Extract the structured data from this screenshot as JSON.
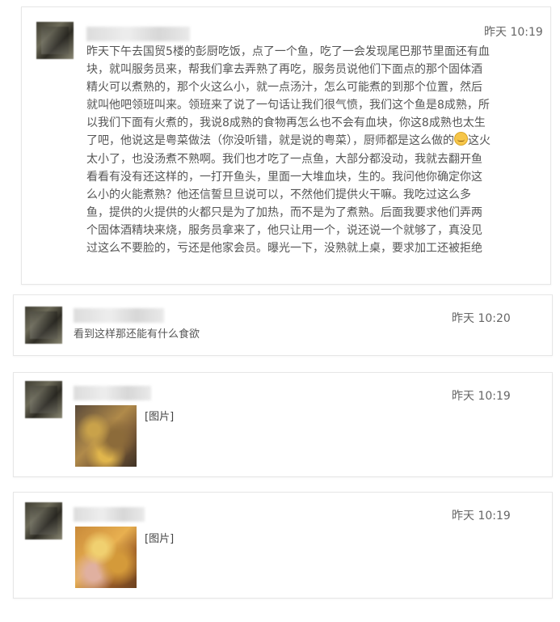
{
  "comments": [
    {
      "time": "昨天 10:19",
      "text_before_emoji": "昨天下午去国贸5楼的彭厨吃饭，点了一个鱼，吃了一会发现尾巴那节里面还有血块，就叫服务员来，帮我们拿去弄熟了再吃，服务员说他们下面点的那个固体酒精火可以煮熟的，那个火这么小，就一点汤汁，怎么可能煮的到那个位置，然后就叫他吧领班叫来。领班来了说了一句话让我们很气愤，我们这个鱼是8成熟，所以我们下面有火煮的，我说8成熟的食物再怎么也不会有血块，你这8成熟也太生了吧，他说这是粤菜做法（你没听错，就是说的粤菜），厨师都是这么做的",
      "emoji": "unamused-face",
      "text_after_emoji": "这火太小了，也没汤煮不熟啊。我们也才吃了一点鱼，大部分都没动，我就去翻开鱼看看有没有还这样的，一打开鱼头，里面一大堆血块，生的。我问他你确定你这么小的火能煮熟？他还信誓旦旦说可以，不然他们提供火干嘛。我吃过这么多鱼，提供的火提供的火都只是为了加热，而不是为了煮熟。后面我要求他们弄两个固体酒精块来烧，服务员拿来了，他只让用一个，说还说一个就够了，真没见过这么不要脸的，亏还是他家会员。曝光一下，没熟就上桌，要求加工还被拒绝"
    },
    {
      "time": "昨天 10:20",
      "text": "看到这样那还能有什么食欲"
    },
    {
      "time": "昨天 10:19",
      "image_label": "[图片]"
    },
    {
      "time": "昨天 10:19",
      "image_label": "[图片]"
    }
  ]
}
